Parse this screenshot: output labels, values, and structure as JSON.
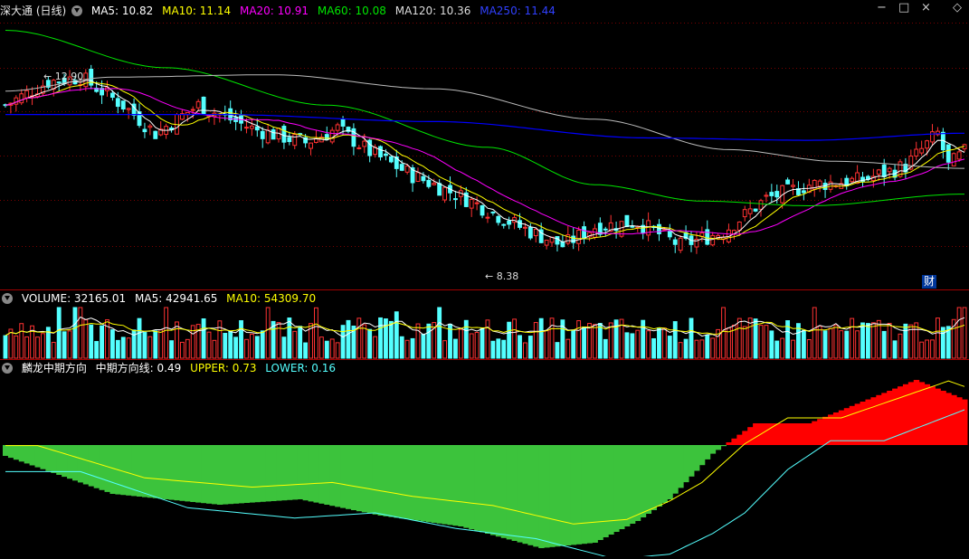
{
  "main_header": {
    "stock": "深大通 (日线)",
    "ma5": "MA5: 10.82",
    "ma10": "MA10: 11.14",
    "ma20": "MA20: 10.91",
    "ma60": "MA60: 10.08",
    "ma120": "MA120: 10.36",
    "ma250": "MA250: 11.44"
  },
  "volume_header": {
    "vol": "VOLUME: 32165.01",
    "ma5": "MA5: 42941.65",
    "ma10": "MA10: 54309.70"
  },
  "indicator_header": {
    "name": "麟龙中期方向",
    "line": "中期方向线: 0.49",
    "upper": "UPPER: 0.73",
    "lower": "LOWER: 0.16"
  },
  "price_annotations": {
    "high": "12.90",
    "low": "8.38"
  },
  "badge": "财",
  "window_controls": [
    "−",
    "□",
    "×",
    "◇"
  ],
  "colors": {
    "up": "#ff3232",
    "down": "#54ffff",
    "ma5": "#ffffff",
    "ma10": "#ffff00",
    "ma20": "#ff00ff",
    "ma60": "#00e600",
    "ma120": "#bbbbbb",
    "ma250": "#0000ff",
    "bull_fill": "#ff0000",
    "bear_fill": "#3cc33c",
    "upper_line": "#ffff00",
    "lower_line": "#54ffff",
    "separator": "#a00000",
    "grid": "#7a0000"
  },
  "chart_data": [
    {
      "type": "candlestick",
      "panel": "price",
      "ylim": [
        8.0,
        13.8
      ],
      "candles": {
        "count": 180,
        "first_close": 12.1,
        "peak_close": 12.6,
        "trough_close": 8.45,
        "last_close": 10.8
      },
      "moving_averages": [
        "MA5",
        "MA10",
        "MA20",
        "MA60",
        "MA120",
        "MA250"
      ],
      "annotations": [
        "12.90",
        "8.38"
      ]
    },
    {
      "type": "bar",
      "panel": "volume",
      "series": [
        {
          "name": "VOLUME"
        },
        {
          "name": "MA5"
        },
        {
          "name": "MA10"
        }
      ],
      "last_values": {
        "VOLUME": 32165.01,
        "MA5": 42941.65,
        "MA10": 54309.7
      }
    },
    {
      "type": "area",
      "panel": "indicator",
      "series": [
        {
          "name": "中期方向线",
          "last": 0.49,
          "min": -0.85,
          "max": 0.6
        },
        {
          "name": "UPPER",
          "last": 0.73
        },
        {
          "name": "LOWER",
          "last": 0.16
        }
      ],
      "zero_line": 0
    }
  ]
}
